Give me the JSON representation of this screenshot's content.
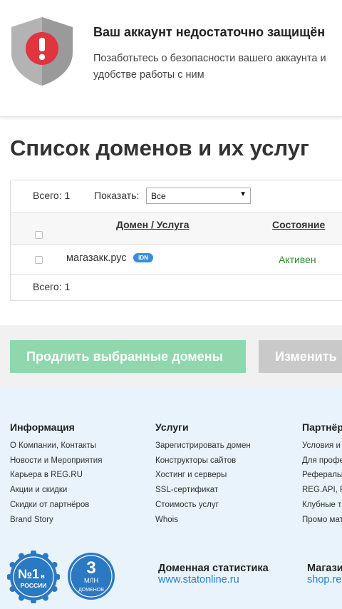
{
  "banner": {
    "title": "Ваш аккаунт недостаточно защищён",
    "text": "Позаботьтесь о безопасности вашего аккаунта и удобстве работы с ним"
  },
  "page": {
    "title": "Список доменов и их услуг"
  },
  "table": {
    "total_top": "Всего: 1",
    "show_label": "Показать:",
    "show_value": "Все",
    "columns": {
      "domain": "Домен / Услуга",
      "status": "Состояние"
    },
    "rows": [
      {
        "domain": "магазакк.рус",
        "badge": "IDN",
        "status": "Активен"
      }
    ],
    "total_bottom": "Всего: 1"
  },
  "actions": {
    "renew_label": "Продлить выбранные домены",
    "change_label": "Изменить"
  },
  "footer": {
    "info": {
      "title": "Информация",
      "links": [
        "О Компании, Контакты",
        "Новости и Мероприятия",
        "Карьера в REG.RU",
        "Акции и скидки",
        "Скидки от партнёров",
        "Brand Story"
      ]
    },
    "services": {
      "title": "Услуги",
      "links": [
        "Зарегистрировать домен",
        "Конструкторы сайтов",
        "Хостинг и серверы",
        "SSL-сертификат",
        "Стоимость услуг",
        "Whois"
      ]
    },
    "partners": {
      "title": "Партнёр",
      "links": [
        "Условия и",
        "Для профе",
        "Реферальн",
        "REG.API, R",
        "Клубные т",
        "Промо мат"
      ]
    },
    "badge1": {
      "line1": "№1",
      "line2": "в",
      "line3": "РОССИИ"
    },
    "badge2": {
      "line1": "3",
      "line2": "МЛН",
      "line3": "ДОМЕНОВ"
    },
    "stats": {
      "title": "Доменная статистика",
      "link": "www.statonline.ru"
    },
    "shop": {
      "title": "Магази",
      "link": "shop.re"
    }
  },
  "colors": {
    "accent_green": "#90d7ad",
    "status_green": "#2f8a2f",
    "badge_blue": "#2b79c2",
    "link_blue": "#2a7fc8",
    "alert_red": "#e0343f"
  }
}
